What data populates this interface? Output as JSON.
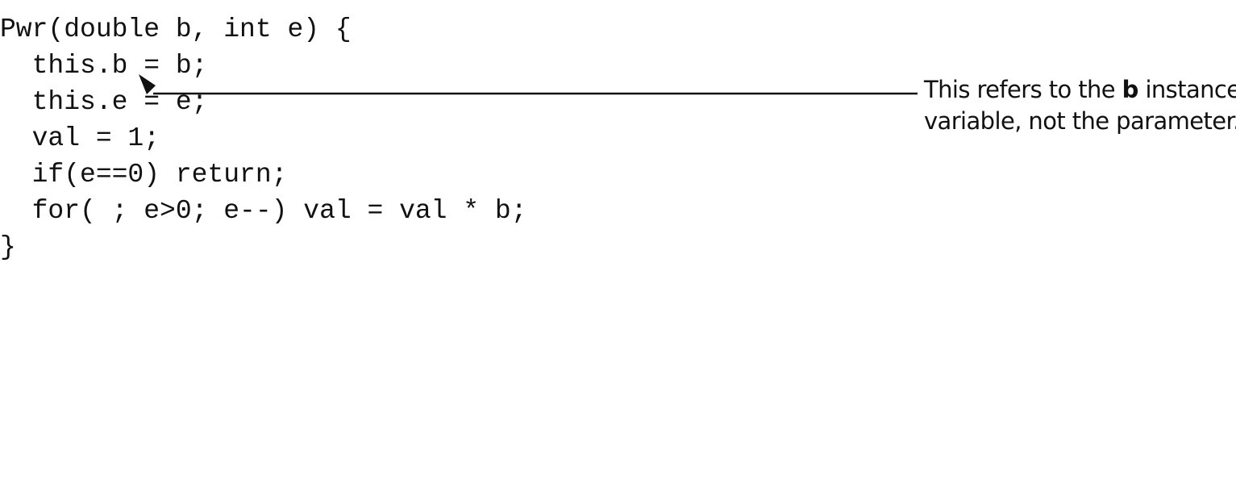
{
  "code": {
    "lines": [
      "Pwr(double b, int e) {",
      "  this.b = b;",
      "  this.e = e;",
      "  val = 1;",
      "  if(e==0) return;",
      "  for( ; e>0; e--) val = val * b;",
      "}"
    ]
  },
  "annotation": {
    "text_before": "This refers to the ",
    "highlight": "b",
    "text_after": " instance",
    "line2": "variable, not the parameter."
  },
  "colors": {
    "ink": "#111111",
    "background": "#ffffff"
  },
  "icons": {
    "pointer": "arrowhead-icon"
  }
}
